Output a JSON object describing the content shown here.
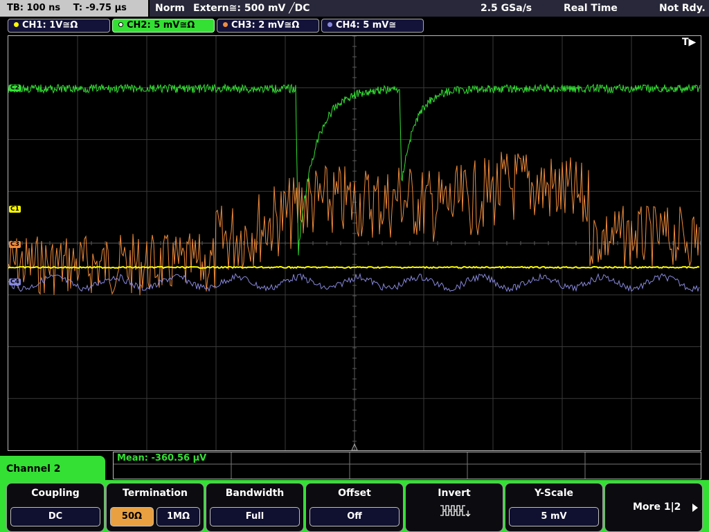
{
  "status": {
    "timebase": "TB: 100 ns",
    "trigger_time": "T: -9.75 µs",
    "mode": "Norm",
    "trigger_source": "Extern≅: 500 mV ╱DC",
    "sample_rate": "2.5 GSa/s",
    "acquisition": "Real Time",
    "state": "Not Rdy."
  },
  "channels": [
    {
      "label": "CH1: 1V≅Ω",
      "color": "#ffff00",
      "active": false
    },
    {
      "label": "CH2: 5 mV≅Ω",
      "color": "#34e034",
      "active": true
    },
    {
      "label": "CH3: 2 mV≅Ω",
      "color": "#f08c3c",
      "active": false
    },
    {
      "label": "CH4: 5 mV≅",
      "color": "#8888dd",
      "active": false
    }
  ],
  "markers": {
    "c1": "C1",
    "c3": "C3",
    "c2": "C2",
    "c4": "C4",
    "trigger_flag": "T▶"
  },
  "measurement": {
    "mean": "Mean: -360.56 µV"
  },
  "menu": {
    "title": "Channel 2",
    "coupling": {
      "title": "Coupling",
      "value": "DC"
    },
    "termination": {
      "title": "Termination",
      "options": [
        "50Ω",
        "1MΩ"
      ],
      "selected": "50Ω"
    },
    "bandwidth": {
      "title": "Bandwidth",
      "value": "Full"
    },
    "offset": {
      "title": "Offset",
      "value": "Off"
    },
    "invert": {
      "title": "Invert"
    },
    "yscale": {
      "title": "Y-Scale",
      "value": "5 mV"
    },
    "more": {
      "label": "More 1|2"
    }
  }
}
